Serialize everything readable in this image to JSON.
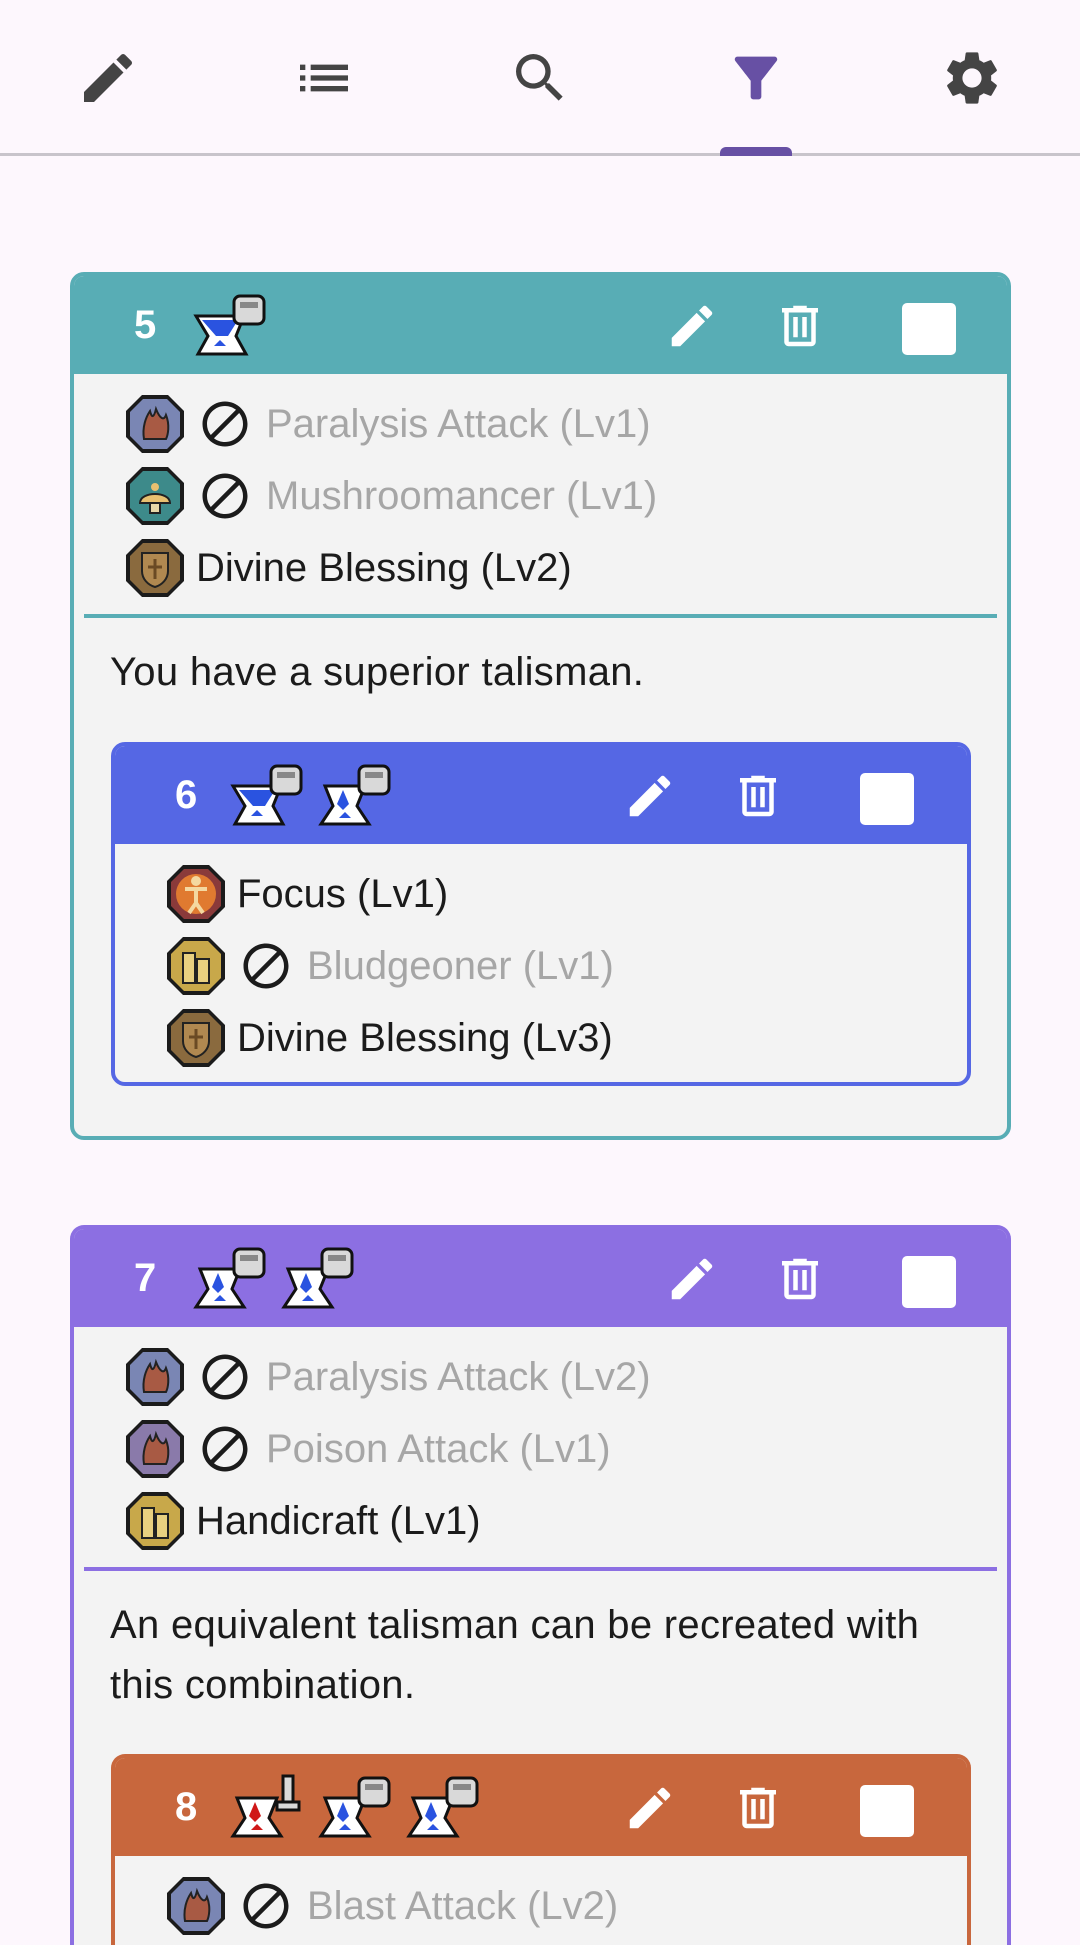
{
  "nav": {
    "tabs": [
      {
        "icon": "pencil-icon",
        "selected": false
      },
      {
        "icon": "list-icon",
        "selected": false
      },
      {
        "icon": "search-icon",
        "selected": false
      },
      {
        "icon": "filter-icon",
        "selected": true
      },
      {
        "icon": "gear-icon",
        "selected": false
      }
    ]
  },
  "colors": {
    "card5": "#58adb5",
    "card6": "#5567e4",
    "card7": "#8c6fe2",
    "card8": "#c8673d",
    "accent": "#6750a4",
    "disabled_text": "#a6a6a6"
  },
  "cards": {
    "c5": {
      "number": "5",
      "skills": [
        {
          "name": "Paralysis Attack (Lv1)",
          "excluded": true,
          "icon": "paralysis-skill-icon"
        },
        {
          "name": "Mushroomancer (Lv1)",
          "excluded": true,
          "icon": "mushroom-skill-icon"
        },
        {
          "name": "Divine Blessing (Lv2)",
          "excluded": false,
          "icon": "shield-skill-icon"
        }
      ],
      "note": "You have a superior talisman."
    },
    "c6": {
      "number": "6",
      "skills": [
        {
          "name": "Focus (Lv1)",
          "excluded": false,
          "icon": "focus-skill-icon"
        },
        {
          "name": "Bludgeoner (Lv1)",
          "excluded": true,
          "icon": "craft-skill-icon"
        },
        {
          "name": "Divine Blessing (Lv3)",
          "excluded": false,
          "icon": "shield-skill-icon"
        }
      ]
    },
    "c7": {
      "number": "7",
      "skills": [
        {
          "name": "Paralysis Attack (Lv2)",
          "excluded": true,
          "icon": "paralysis-skill-icon"
        },
        {
          "name": "Poison Attack (Lv1)",
          "excluded": true,
          "icon": "poison-skill-icon"
        },
        {
          "name": "Handicraft (Lv1)",
          "excluded": false,
          "icon": "craft-skill-icon"
        }
      ],
      "note": "An equivalent talisman can be recreated with this combination."
    },
    "c8": {
      "number": "8",
      "skills": [
        {
          "name": "Blast Attack (Lv2)",
          "excluded": true,
          "icon": "blast-skill-icon"
        }
      ]
    }
  }
}
